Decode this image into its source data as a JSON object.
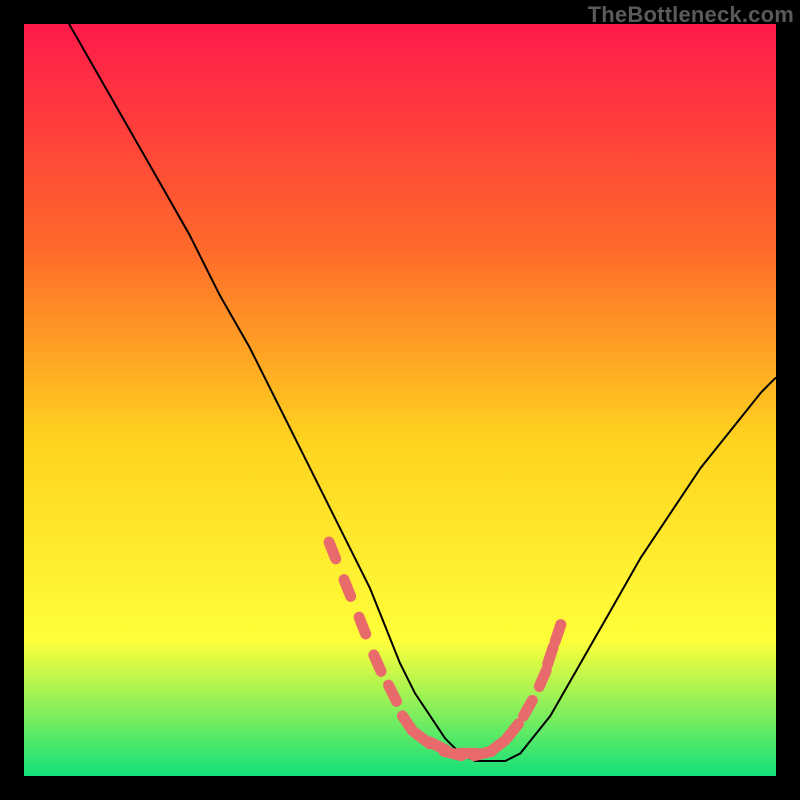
{
  "watermark": "TheBottleneck.com",
  "chart_data": {
    "type": "line",
    "title": "",
    "xlabel": "",
    "ylabel": "",
    "xlim": [
      0,
      100
    ],
    "ylim": [
      0,
      100
    ],
    "grid": false,
    "legend": false,
    "background_gradient": {
      "top_color": "#ff1a4b",
      "upper_mid_color": "#ff6a2a",
      "mid_color": "#ffd21f",
      "lower_mid_color": "#ffff3a",
      "bottom_color": "#13e07a"
    },
    "series": [
      {
        "name": "bottleneck-curve",
        "type": "line",
        "color": "#000000",
        "x": [
          6,
          10,
          14,
          18,
          22,
          26,
          30,
          34,
          38,
          42,
          46,
          50,
          52,
          54,
          56,
          58,
          60,
          62,
          64,
          66,
          70,
          74,
          78,
          82,
          86,
          90,
          94,
          98,
          100
        ],
        "y": [
          100,
          93,
          86,
          79,
          72,
          64,
          57,
          49,
          41,
          33,
          25,
          15,
          11,
          8,
          5,
          3,
          2,
          2,
          2,
          3,
          8,
          15,
          22,
          29,
          35,
          41,
          46,
          51,
          53
        ]
      },
      {
        "name": "optimal-region-markers",
        "type": "scatter",
        "color": "#e96a6a",
        "x": [
          41,
          43,
          45,
          47,
          49,
          51,
          53,
          55,
          57,
          59,
          61,
          63,
          65,
          67,
          69,
          70,
          71
        ],
        "y": [
          30,
          25,
          20,
          15,
          11,
          7,
          5,
          4,
          3,
          3,
          3,
          4,
          6,
          9,
          13,
          16,
          19
        ]
      }
    ]
  }
}
